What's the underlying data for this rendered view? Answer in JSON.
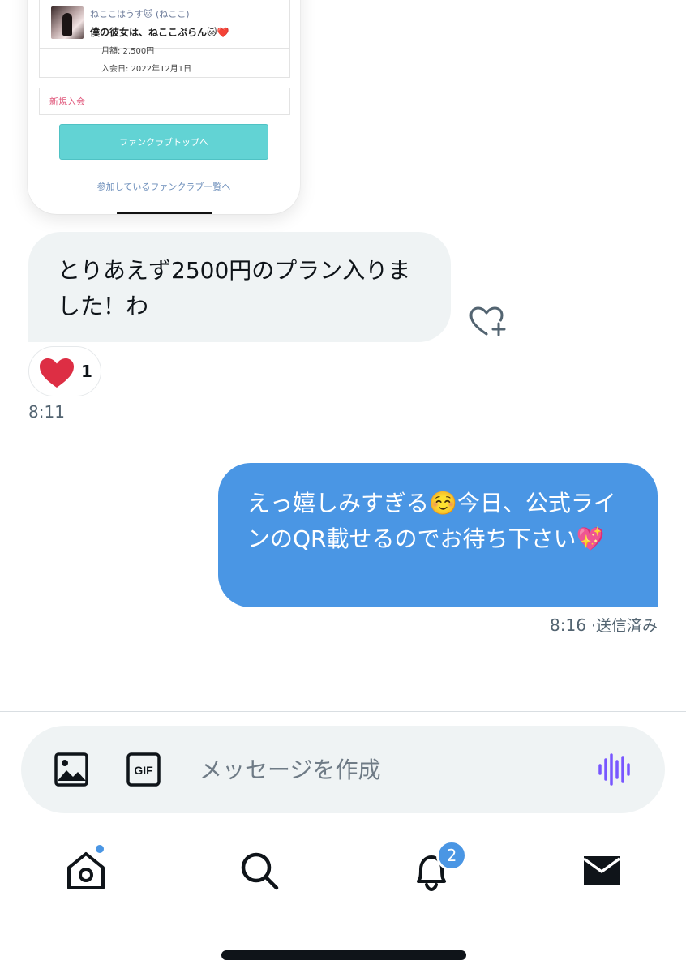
{
  "embedded_screenshot": {
    "member_name": "ねここはうす🐱 (ねここ)",
    "member_title": "僕の彼女は、ねここぷらん🐱❤️",
    "monthly_fee": "月額: 2,500円",
    "joined_date": "入会日: 2022年12月1日",
    "new_join_label": "新規入会",
    "club_top_button": "ファンクラブトップへ",
    "club_list_link": "参加しているファンクラブ一覧へ"
  },
  "messages": {
    "incoming": {
      "text": "とりあえず2500円のプラン入りました！わ",
      "reaction_count": "1",
      "time": "8:11"
    },
    "outgoing": {
      "text": "えっ嬉しみすぎる☺️今日、公式ラインのQR載せるのでお待ち下さい💖",
      "time": "8:16",
      "status": "·送信済み"
    }
  },
  "composer": {
    "placeholder": "メッセージを作成",
    "image_icon": "image-icon",
    "gif_icon": "gif-icon",
    "voice_icon": "voice-icon"
  },
  "tabbar": {
    "items": [
      "home-icon",
      "search-icon",
      "bell-icon",
      "mail-icon"
    ],
    "notification_count": "2"
  },
  "colors": {
    "accent": "#4a96e4",
    "incoming_bubble": "#eff3f4",
    "heart": "#e0245e",
    "voice": "#7856ff",
    "club_button": "#62d3d4"
  }
}
